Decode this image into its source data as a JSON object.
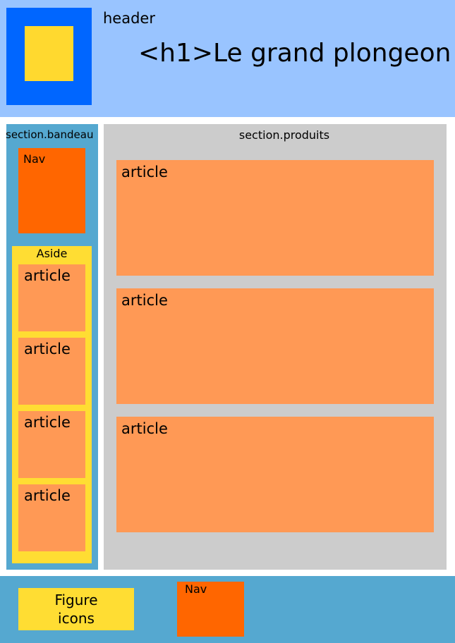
{
  "header": {
    "label": "header",
    "title": "<h1>Le grand plongeon"
  },
  "bandeau": {
    "label": "section.bandeau",
    "nav_label": "Nav",
    "aside": {
      "label": "Aside",
      "articles": [
        "article",
        "article",
        "article",
        "article"
      ]
    }
  },
  "produits": {
    "label": "section.produits",
    "articles": [
      "article",
      "article",
      "article"
    ]
  },
  "footer": {
    "figure_label": "Figure\nicons",
    "nav_label": "Nav"
  },
  "colors": {
    "header": "#99c4ff",
    "logo_outer": "#0066ff",
    "logo_inner": "#ffd92f",
    "section": "#55a8d0",
    "nav": "#ff6600",
    "aside": "#ffdd33",
    "article": "#ff9955",
    "produits": "#cccccc"
  }
}
